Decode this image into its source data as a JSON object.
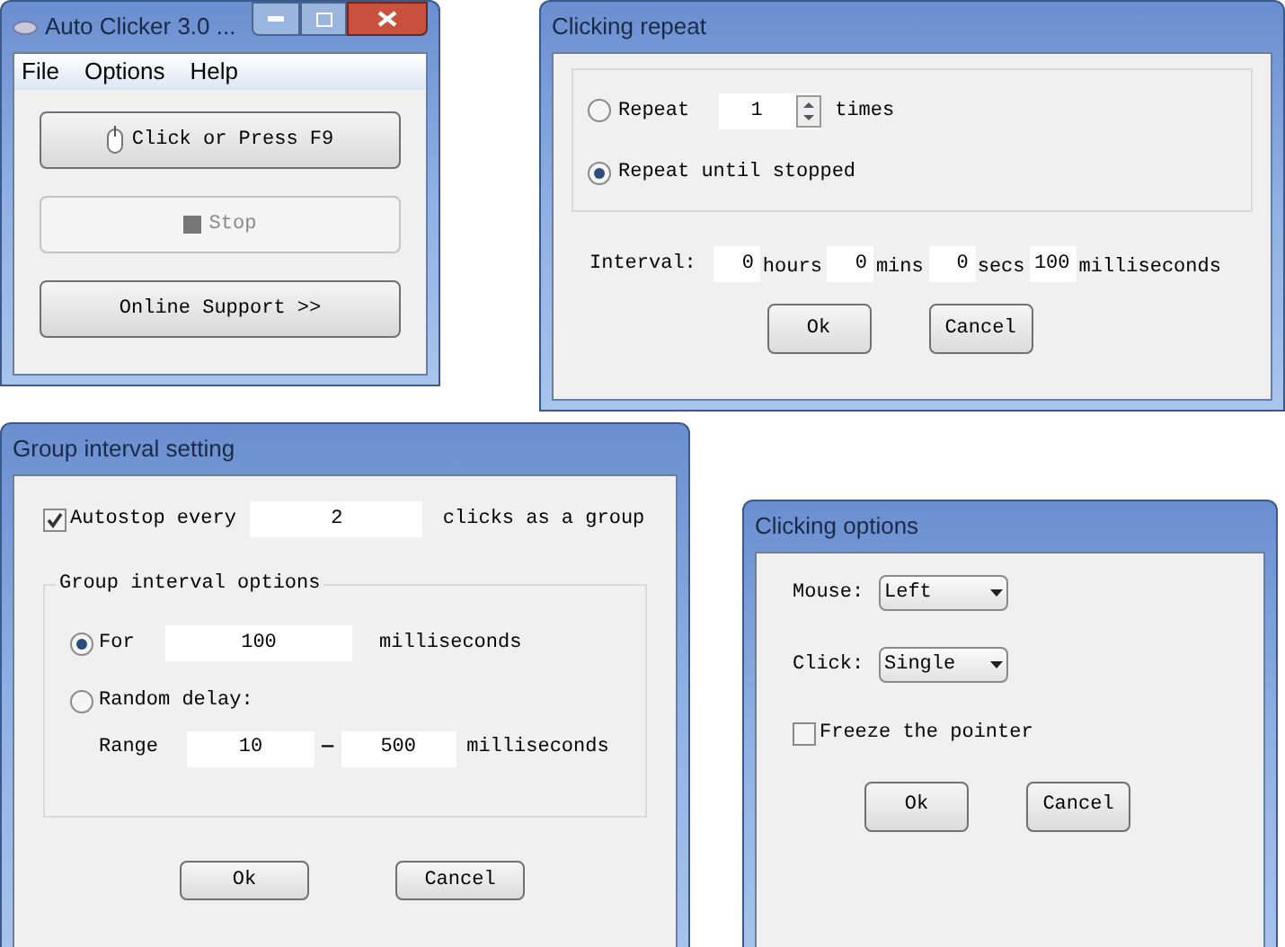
{
  "main_window": {
    "title": "Auto Clicker 3.0 ...",
    "menu": [
      "File",
      "Options",
      "Help"
    ],
    "buttons": [
      {
        "label": "Click or Press F9",
        "kind": "mouse",
        "disabled": false
      },
      {
        "label": "Stop",
        "kind": "stop",
        "disabled": true
      },
      {
        "label": "Online Support >>",
        "kind": "plain",
        "disabled": false
      }
    ]
  },
  "repeat_dialog": {
    "title": "Clicking repeat",
    "options": [
      {
        "kind": "count",
        "label": "Repeat",
        "selected": false,
        "value": "1",
        "suffix": "times"
      },
      {
        "kind": "plain",
        "label": "Repeat until stopped",
        "selected": true
      }
    ],
    "interval_label": "Interval:",
    "interval": [
      {
        "value": "0",
        "unit": "hours"
      },
      {
        "value": "0",
        "unit": "mins"
      },
      {
        "value": "0",
        "unit": "secs"
      },
      {
        "value": "100",
        "unit": "milliseconds"
      }
    ],
    "buttons": [
      "Ok",
      "Cancel"
    ]
  },
  "group_dialog": {
    "title": "Group interval setting",
    "autostop": {
      "label": "Autostop every",
      "checked": true,
      "value": "2",
      "suffix": "clicks as a group"
    },
    "group_title": "Group interval options",
    "options": [
      {
        "kind": "fixed",
        "label": "For",
        "selected": true,
        "value": "100",
        "suffix": "milliseconds"
      },
      {
        "kind": "random",
        "label": "Random delay:",
        "selected": false,
        "range_label": "Range",
        "from": "10",
        "separator": "—",
        "to": "500",
        "suffix": "milliseconds"
      }
    ],
    "buttons": [
      "Ok",
      "Cancel"
    ]
  },
  "options_dialog": {
    "title": "Clicking options",
    "selects": [
      {
        "label": "Mouse:",
        "value": "Left"
      },
      {
        "label": "Click:",
        "value": "Single"
      }
    ],
    "freeze": {
      "label": "Freeze the pointer",
      "checked": false
    },
    "buttons": [
      "Ok",
      "Cancel"
    ]
  }
}
